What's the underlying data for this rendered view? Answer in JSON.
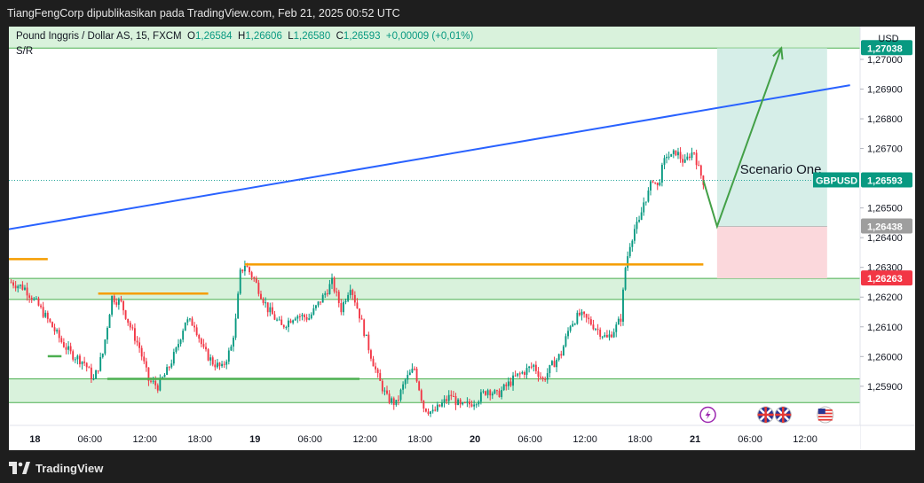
{
  "header": {
    "publisher_line": "TiangFengCorp dipublikasikan pada TradingView.com, Feb 21, 2025 00:52 UTC"
  },
  "legend": {
    "symbol": "Pound Inggris / Dollar AS, 15, FXCM",
    "o_label": "O",
    "o_value": "1,26584",
    "h_label": "H",
    "h_value": "1,26606",
    "l_label": "L",
    "l_value": "1,26580",
    "c_label": "C",
    "c_value": "1,26593",
    "change": "+0,00009 (+0,01%)",
    "indicator": "S/R"
  },
  "currency": "USD",
  "footer": {
    "brand": "TradingView"
  },
  "colors": {
    "bull": "#089981",
    "bear": "#f23645",
    "trendline": "#2962ff",
    "sr_level": "#f59d00",
    "zone_fill": "#d9f2dc",
    "zone_border": "#4caf50",
    "target_fill": "#d1ece6",
    "stop_fill": "#fbd6da",
    "arrow": "#43a047"
  },
  "chart_data": {
    "type": "candlestick",
    "symbol": "GBPUSD",
    "timeframe": "15",
    "ylim": [
      1.2582,
      1.27105
    ],
    "y_ticks": [
      "1,27000",
      "1,26900",
      "1,26800",
      "1,26700",
      "1,26500",
      "1,26400",
      "1,26300",
      "1,26200",
      "1,26100",
      "1,26000",
      "1,25900"
    ],
    "y_tick_values": [
      1.27,
      1.269,
      1.268,
      1.267,
      1.265,
      1.264,
      1.263,
      1.262,
      1.261,
      1.26,
      1.259
    ],
    "x_ticks": [
      {
        "label": "18",
        "t": 0.1,
        "bold": true
      },
      {
        "label": "06:00",
        "t": 6.1
      },
      {
        "label": "12:00",
        "t": 12.1
      },
      {
        "label": "18:00",
        "t": 18.1
      },
      {
        "label": "19",
        "t": 24.1,
        "bold": true
      },
      {
        "label": "06:00",
        "t": 30.1
      },
      {
        "label": "12:00",
        "t": 36.1
      },
      {
        "label": "18:00",
        "t": 42.1
      },
      {
        "label": "20",
        "t": 48.1,
        "bold": true
      },
      {
        "label": "06:00",
        "t": 54.1
      },
      {
        "label": "12:00",
        "t": 60.1
      },
      {
        "label": "18:00",
        "t": 66.1
      },
      {
        "label": "21",
        "t": 72.1,
        "bold": true
      },
      {
        "label": "06:00",
        "t": 78.1
      },
      {
        "label": "12:00",
        "t": 84.1
      }
    ],
    "price_path": [
      [
        -2.5,
        1.2625
      ],
      [
        -1.0,
        1.2623
      ],
      [
        0.5,
        1.2617
      ],
      [
        2.0,
        1.261
      ],
      [
        3.0,
        1.2605
      ],
      [
        4.0,
        1.2601
      ],
      [
        5.5,
        1.2598
      ],
      [
        6.5,
        1.2592
      ],
      [
        7.5,
        1.2601
      ],
      [
        8.5,
        1.262
      ],
      [
        9.5,
        1.2618
      ],
      [
        10.5,
        1.261
      ],
      [
        11.5,
        1.2603
      ],
      [
        12.5,
        1.2592
      ],
      [
        13.5,
        1.259
      ],
      [
        14.5,
        1.2595
      ],
      [
        15.5,
        1.2602
      ],
      [
        16.5,
        1.2612
      ],
      [
        17.5,
        1.2611
      ],
      [
        18.5,
        1.2602
      ],
      [
        19.5,
        1.2598
      ],
      [
        20.5,
        1.2596
      ],
      [
        21.5,
        1.2603
      ],
      [
        22.0,
        1.2612
      ],
      [
        22.5,
        1.2628
      ],
      [
        23.0,
        1.2631
      ],
      [
        24.0,
        1.2626
      ],
      [
        25.5,
        1.2616
      ],
      [
        27.0,
        1.261
      ],
      [
        28.5,
        1.2614
      ],
      [
        30.0,
        1.2613
      ],
      [
        31.5,
        1.262
      ],
      [
        32.5,
        1.2625
      ],
      [
        33.5,
        1.2616
      ],
      [
        34.5,
        1.2624
      ],
      [
        35.5,
        1.2614
      ],
      [
        36.5,
        1.2603
      ],
      [
        37.5,
        1.2593
      ],
      [
        38.5,
        1.2586
      ],
      [
        39.5,
        1.2584
      ],
      [
        40.5,
        1.2592
      ],
      [
        41.5,
        1.2596
      ],
      [
        42.5,
        1.2583
      ],
      [
        43.5,
        1.2581
      ],
      [
        44.5,
        1.2584
      ],
      [
        45.5,
        1.2587
      ],
      [
        46.5,
        1.2583
      ],
      [
        47.5,
        1.2584
      ],
      [
        48.5,
        1.2586
      ],
      [
        49.5,
        1.2589
      ],
      [
        50.5,
        1.2587
      ],
      [
        51.5,
        1.259
      ],
      [
        52.5,
        1.2593
      ],
      [
        53.5,
        1.2595
      ],
      [
        54.5,
        1.2597
      ],
      [
        55.5,
        1.2592
      ],
      [
        56.5,
        1.2597
      ],
      [
        57.5,
        1.2601
      ],
      [
        58.5,
        1.2611
      ],
      [
        59.5,
        1.2614
      ],
      [
        60.5,
        1.2612
      ],
      [
        61.5,
        1.2609
      ],
      [
        62.5,
        1.2606
      ],
      [
        63.5,
        1.261
      ],
      [
        64.0,
        1.2613
      ],
      [
        64.5,
        1.263
      ],
      [
        65.0,
        1.2638
      ],
      [
        65.5,
        1.2643
      ],
      [
        66.0,
        1.2645
      ],
      [
        66.5,
        1.2652
      ],
      [
        67.0,
        1.2655
      ],
      [
        67.5,
        1.266
      ],
      [
        68.0,
        1.2657
      ],
      [
        68.5,
        1.2663
      ],
      [
        69.0,
        1.2668
      ],
      [
        69.5,
        1.2667
      ],
      [
        70.0,
        1.2669
      ],
      [
        70.5,
        1.2667
      ],
      [
        71.0,
        1.2665
      ],
      [
        71.5,
        1.2668
      ],
      [
        72.0,
        1.2669
      ],
      [
        72.5,
        1.2663
      ],
      [
        73.0,
        1.2659
      ]
    ],
    "candle_step_hours": 0.25,
    "last_price": {
      "label": "GBPUSD",
      "value": "1,26593",
      "y": 1.26593
    },
    "trendline": {
      "start": [
        -3.0,
        1.26427
      ],
      "end": [
        89.0,
        1.26913
      ]
    },
    "sr_levels": [
      {
        "y": 1.26328,
        "t_start": -3.0,
        "t_end": 1.5
      },
      {
        "y": 1.2631,
        "t_start": 23.0,
        "t_end": 73.0
      },
      {
        "y": 1.26212,
        "t_start": 7.0,
        "t_end": 19.0
      },
      {
        "y": 1.26001,
        "t_start": 1.5,
        "t_end": 3.0
      },
      {
        "y": 1.25925,
        "t_start": 8.0,
        "t_end": 35.5
      }
    ],
    "zones": [
      {
        "y_top": 1.26263,
        "y_bottom": 1.26192
      },
      {
        "y_top": 1.25925,
        "y_bottom": 1.25845
      }
    ],
    "top_zone": {
      "y_top": 1.27105,
      "y_bottom": 1.27038
    },
    "position": {
      "t_start": 74.5,
      "t_end": 86.5,
      "target": 1.27038,
      "entry": 1.26438,
      "stop": 1.26263
    },
    "scenario_path": [
      [
        73.0,
        1.26593
      ],
      [
        74.5,
        1.26438
      ],
      [
        81.5,
        1.27038
      ]
    ],
    "annotation": {
      "text": "Scenario One",
      "t": 77.0,
      "y": 1.26615
    },
    "price_tags": [
      {
        "value": "1,27038",
        "y": 1.27038,
        "kind": "target"
      },
      {
        "value": "1,26593",
        "y": 1.26593,
        "kind": "last"
      },
      {
        "value": "1,26438",
        "y": 1.26438,
        "kind": "entry"
      },
      {
        "value": "1,26263",
        "y": 1.26263,
        "kind": "stop"
      }
    ],
    "events": [
      {
        "t": 73.5,
        "icon": "lightning-icon"
      },
      {
        "t": 79.8,
        "icon": "uk-flag-icon"
      },
      {
        "t": 81.7,
        "icon": "uk-flag-icon"
      },
      {
        "t": 86.3,
        "icon": "us-flag-icon"
      }
    ]
  }
}
